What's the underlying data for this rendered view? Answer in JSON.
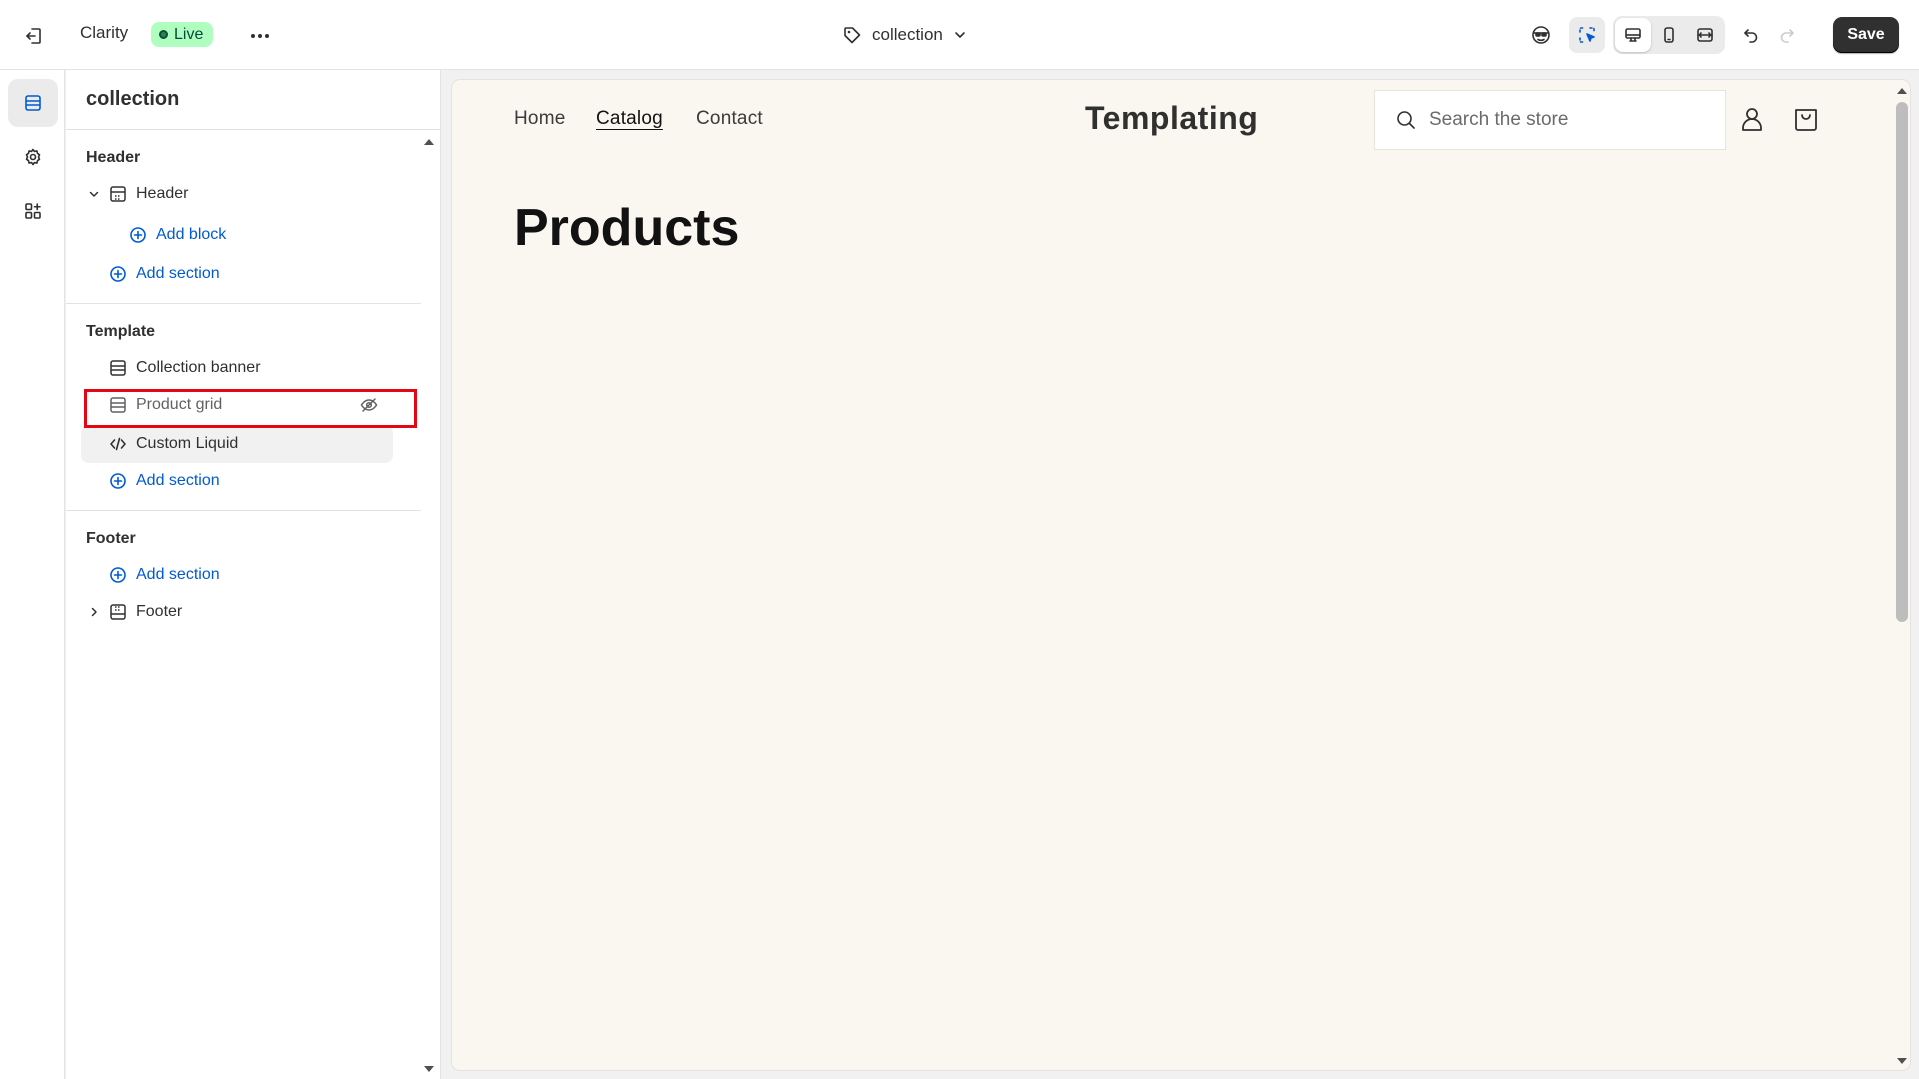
{
  "topbar": {
    "theme_name": "Clarity",
    "status_badge": "Live",
    "template_label": "collection",
    "save_label": "Save"
  },
  "sidebar": {
    "title": "collection",
    "groups": {
      "header": {
        "label": "Header",
        "section": "Header",
        "add_block": "Add block",
        "add_section": "Add section"
      },
      "template": {
        "label": "Template",
        "sections": [
          "Collection banner",
          "Product grid",
          "Custom Liquid"
        ],
        "add_section": "Add section"
      },
      "footer": {
        "label": "Footer",
        "add_section": "Add section",
        "section": "Footer"
      }
    }
  },
  "preview": {
    "nav": [
      "Home",
      "Catalog",
      "Contact"
    ],
    "brand": "Templating",
    "search_placeholder": "Search the store",
    "page_heading": "Products"
  },
  "colors": {
    "accent": "#005bd3",
    "live_badge": "#affebf",
    "highlight": "#e30613",
    "preview_bg": "#faf6f0"
  }
}
